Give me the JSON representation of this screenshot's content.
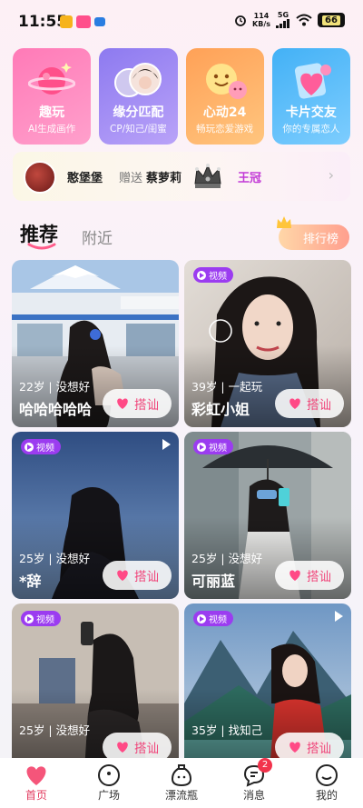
{
  "status_bar": {
    "time": "11:55",
    "net_speed_value": "114",
    "net_speed_unit": "KB/s",
    "network": "5G",
    "battery": "66"
  },
  "features": [
    {
      "title": "趣玩",
      "subtitle": "AI生成画作",
      "colors": [
        "#ff78b9",
        "#ff9ac8"
      ],
      "icon": "planet-icon"
    },
    {
      "title": "缘分匹配",
      "subtitle": "CP/知己/闺蜜",
      "colors": [
        "#8f7bf2",
        "#b59cf7"
      ],
      "icon": "couple-avatars-icon"
    },
    {
      "title": "心动24",
      "subtitle": "畅玩恋爱游戏",
      "colors": [
        "#ffa35a",
        "#ffc27a"
      ],
      "icon": "bubble-faces-icon"
    },
    {
      "title": "卡片交友",
      "subtitle": "你的专属恋人",
      "colors": [
        "#46b3f7",
        "#7acbff"
      ],
      "icon": "card-hearts-icon"
    }
  ],
  "banner": {
    "sender": "憨堡堡",
    "action": "赠送",
    "receiver": "蔡萝莉",
    "gift": "王冠"
  },
  "tabs": {
    "recommend": "推荐",
    "nearby": "附近",
    "rank": "排行榜"
  },
  "cards": [
    {
      "age_line": "22岁 | 没想好",
      "name": "哈哈哈哈哈",
      "video": false,
      "play": false,
      "chat": "搭讪"
    },
    {
      "age_line": "39岁 | 一起玩",
      "name": "彩虹小姐",
      "video": true,
      "play": false,
      "chat": "搭讪"
    },
    {
      "age_line": "25岁 | 没想好",
      "name": "*辞",
      "video": true,
      "play": true,
      "chat": "搭讪"
    },
    {
      "age_line": "25岁 | 没想好",
      "name": "可丽蓝",
      "video": true,
      "play": false,
      "chat": "搭讪"
    },
    {
      "age_line": "25岁 | 没想好",
      "name": "",
      "video": true,
      "play": false,
      "chat": "搭讪"
    },
    {
      "age_line": "35岁 | 找知己",
      "name": "",
      "video": true,
      "play": true,
      "chat": "搭讪"
    }
  ],
  "video_badge": "视频",
  "nav": [
    {
      "label": "首页",
      "icon": "heart-icon",
      "active": true
    },
    {
      "label": "广场",
      "icon": "face-circle-icon",
      "active": false
    },
    {
      "label": "漂流瓶",
      "icon": "bottle-icon",
      "active": false
    },
    {
      "label": "消息",
      "icon": "chat-bubble-icon",
      "active": false,
      "badge": "2"
    },
    {
      "label": "我的",
      "icon": "smile-circle-icon",
      "active": false
    }
  ]
}
